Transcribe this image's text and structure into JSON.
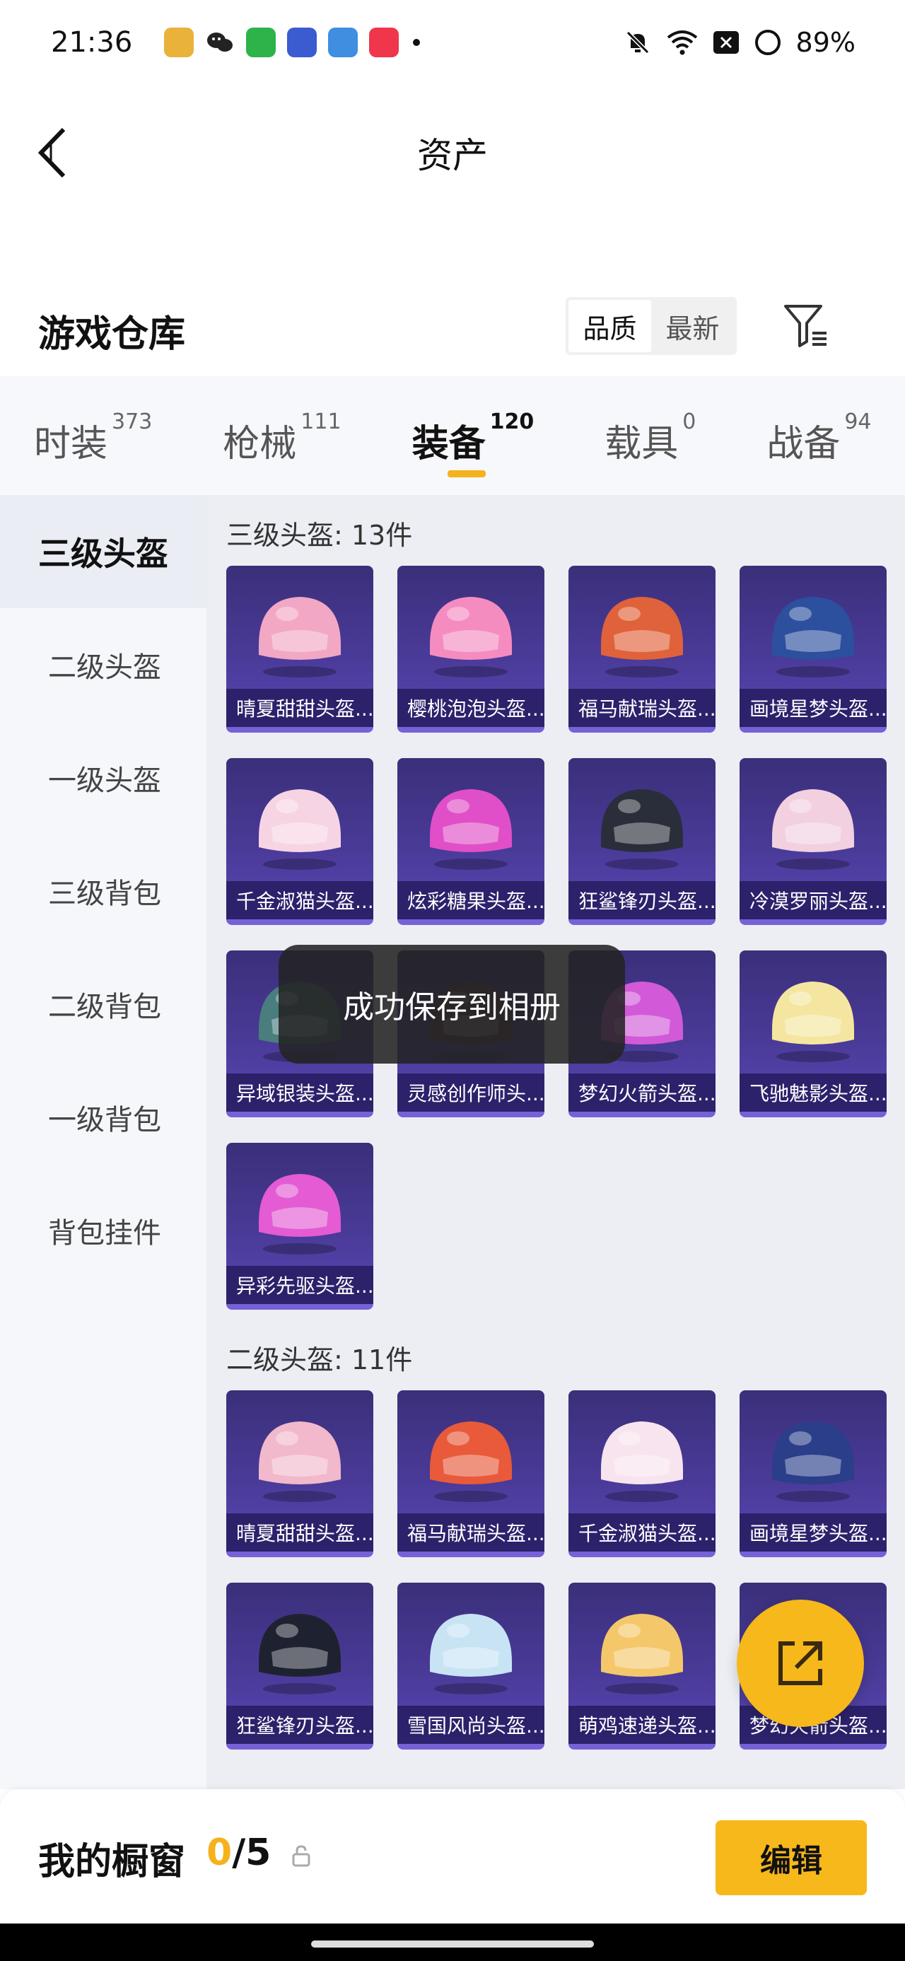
{
  "status_bar": {
    "time": "21:36",
    "battery": "89%",
    "icons": [
      "game-app-icon",
      "wechat-icon",
      "shield-app-icon",
      "game-app2-icon",
      "game-app3-icon",
      "music-app-icon",
      "mute-icon",
      "wifi-icon",
      "close-box-icon",
      "battery-ring-icon"
    ]
  },
  "header": {
    "title": "资产"
  },
  "warehouse": {
    "title": "游戏仓库",
    "toggle": [
      "品质",
      "最新"
    ],
    "active_toggle": "品质"
  },
  "tabs": [
    {
      "label": "时装",
      "count": "373"
    },
    {
      "label": "枪械",
      "count": "111"
    },
    {
      "label": "装备",
      "count": "120"
    },
    {
      "label": "载具",
      "count": "0"
    },
    {
      "label": "战备",
      "count": "94"
    }
  ],
  "active_tab": "装备",
  "sidebar": {
    "items": [
      "三级头盔",
      "二级头盔",
      "一级头盔",
      "三级背包",
      "二级背包",
      "一级背包",
      "背包挂件"
    ],
    "active": "三级头盔"
  },
  "sections": [
    {
      "title": "三级头盔: 13件",
      "items": [
        {
          "name": "晴夏甜甜头盔...",
          "color": "#f2a8c4"
        },
        {
          "name": "樱桃泡泡头盔...",
          "color": "#f58cc0"
        },
        {
          "name": "福马献瑞头盔...",
          "color": "#e0623a"
        },
        {
          "name": "画境星梦头盔...",
          "color": "#2c4f9e"
        },
        {
          "name": "千金淑猫头盔...",
          "color": "#f7d4e4"
        },
        {
          "name": "炫彩糖果头盔...",
          "color": "#e04fc8"
        },
        {
          "name": "狂鲨锋刃头盔...",
          "color": "#2a2e3a"
        },
        {
          "name": "冷漠罗丽头盔...",
          "color": "#f2d0e0"
        },
        {
          "name": "异域银装头盔...",
          "color": "#4a7d7e"
        },
        {
          "name": "灵感创作师头...",
          "color": "#5a3a40"
        },
        {
          "name": "梦幻火箭头盔...",
          "color": "#d25ad8"
        },
        {
          "name": "飞驰魅影头盔...",
          "color": "#f4e6a0"
        },
        {
          "name": "异彩先驱头盔...",
          "color": "#e45bd4"
        }
      ]
    },
    {
      "title": "二级头盔: 11件",
      "items": [
        {
          "name": "晴夏甜甜头盔...",
          "color": "#f2b8cc"
        },
        {
          "name": "福马献瑞头盔...",
          "color": "#e85a3a"
        },
        {
          "name": "千金淑猫头盔...",
          "color": "#f8e4ee"
        },
        {
          "name": "画境星梦头盔...",
          "color": "#2a3e8a"
        },
        {
          "name": "狂鲨锋刃头盔...",
          "color": "#1e2230"
        },
        {
          "name": "雪国风尚头盔...",
          "color": "#c8e4f4"
        },
        {
          "name": "萌鸡速递头盔...",
          "color": "#f4c86a"
        },
        {
          "name": "梦幻火箭头盔...",
          "color": "#d25ad8"
        }
      ]
    }
  ],
  "toast": "成功保存到相册",
  "showcase": {
    "label": "我的橱窗",
    "current": "0",
    "total": "/5"
  },
  "edit_label": "编辑",
  "accent_color": "#f6b81b"
}
